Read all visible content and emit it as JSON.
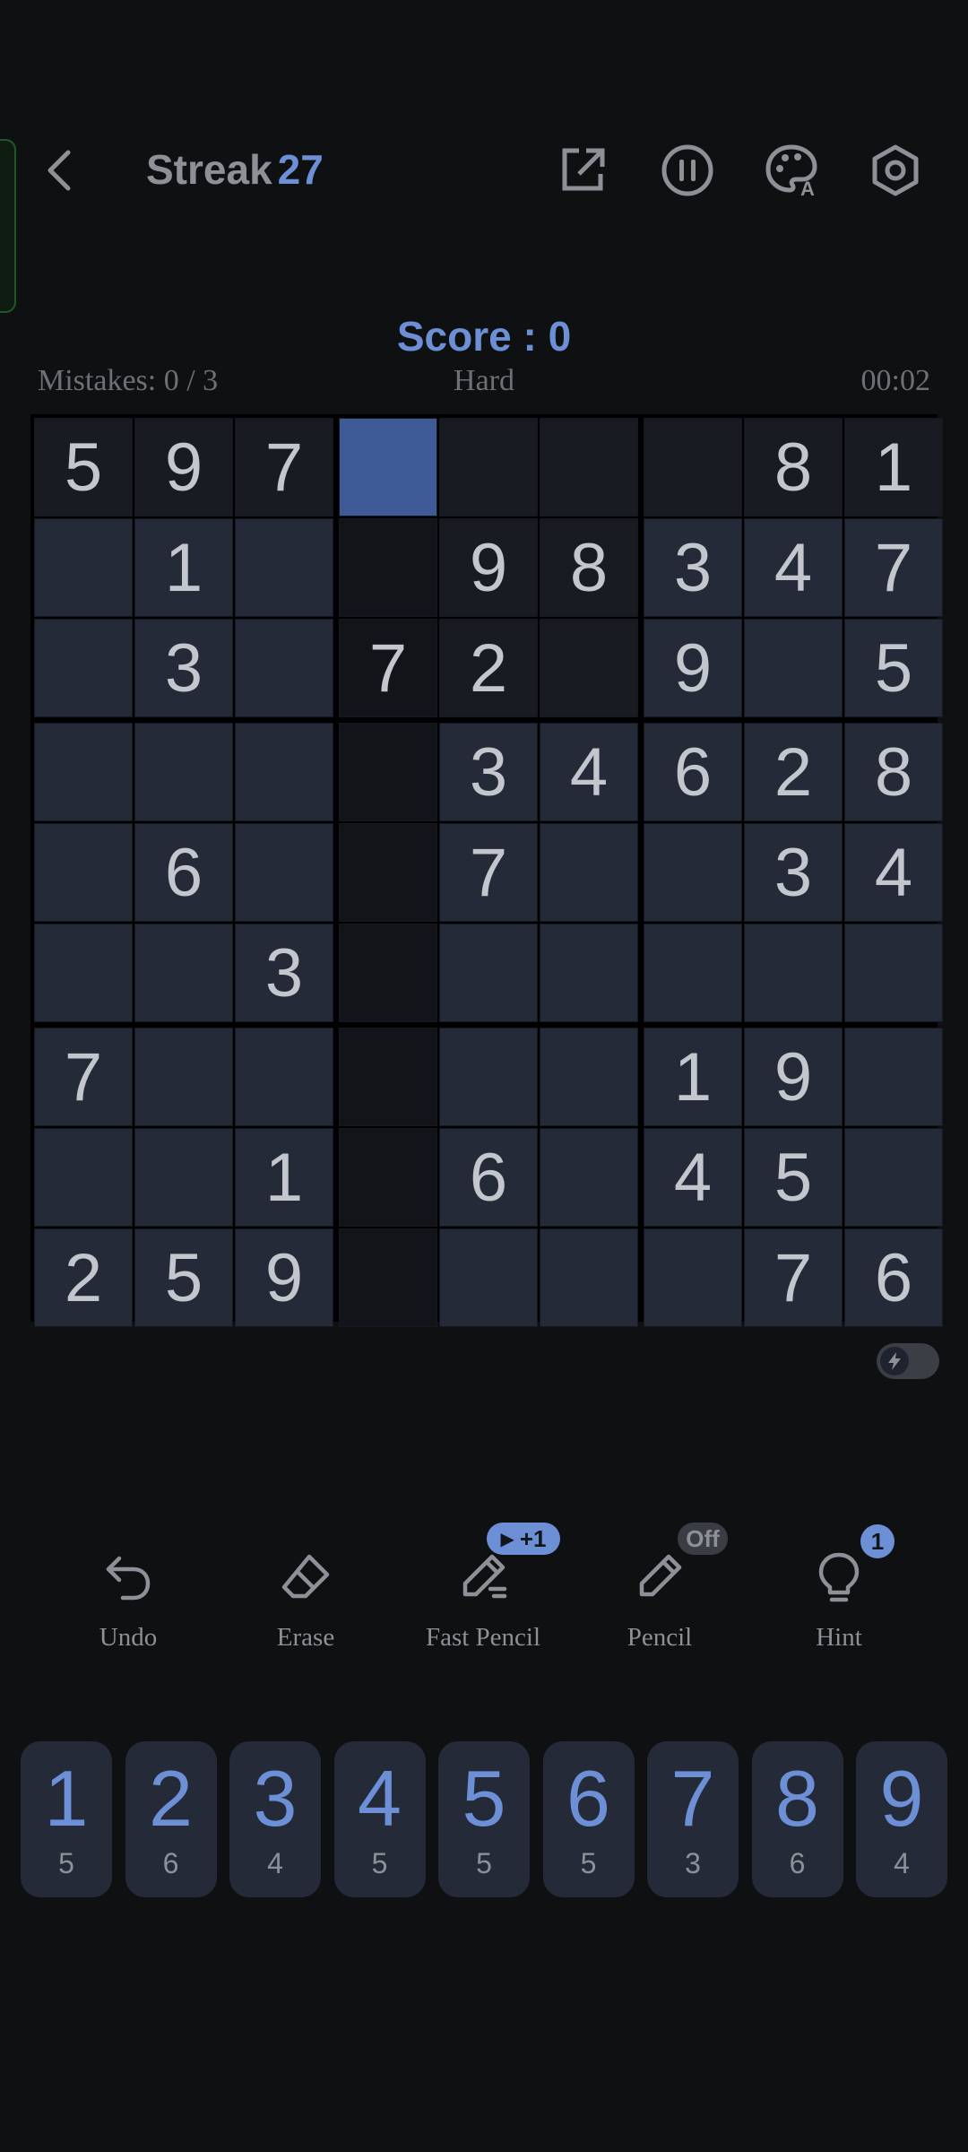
{
  "header": {
    "streak_label": "Streak",
    "streak_value": "27",
    "icons": [
      "back-icon",
      "share-icon",
      "pause-icon",
      "palette-icon",
      "settings-icon"
    ]
  },
  "score_text": "Score : 0",
  "info": {
    "mistakes": "Mistakes: 0 / 3",
    "difficulty": "Hard",
    "timer": "00:02"
  },
  "board": {
    "selected": [
      0,
      3
    ],
    "cells": [
      [
        "5",
        "9",
        "7",
        "",
        "",
        "",
        "",
        "8",
        "1"
      ],
      [
        "",
        "1",
        "",
        "",
        "9",
        "8",
        "3",
        "4",
        "7"
      ],
      [
        "",
        "3",
        "",
        "7",
        "2",
        "",
        "9",
        "",
        "5"
      ],
      [
        "",
        "",
        "",
        "",
        "3",
        "4",
        "6",
        "2",
        "8"
      ],
      [
        "",
        "6",
        "",
        "",
        "7",
        "",
        "",
        "3",
        "4"
      ],
      [
        "",
        "",
        "3",
        "",
        "",
        "",
        "",
        "",
        ""
      ],
      [
        "7",
        "",
        "",
        "",
        "",
        "",
        "1",
        "9",
        ""
      ],
      [
        "",
        "",
        "1",
        "",
        "6",
        "",
        "4",
        "5",
        ""
      ],
      [
        "2",
        "5",
        "9",
        "",
        "",
        "",
        "",
        "7",
        "6"
      ]
    ]
  },
  "tools": {
    "undo": {
      "label": "Undo"
    },
    "erase": {
      "label": "Erase"
    },
    "fast_pencil": {
      "label": "Fast Pencil",
      "badge": "+1"
    },
    "pencil": {
      "label": "Pencil",
      "badge": "Off"
    },
    "hint": {
      "label": "Hint",
      "badge": "1"
    }
  },
  "numpad": [
    {
      "digit": "1",
      "count": "5"
    },
    {
      "digit": "2",
      "count": "6"
    },
    {
      "digit": "3",
      "count": "4"
    },
    {
      "digit": "4",
      "count": "5"
    },
    {
      "digit": "5",
      "count": "5"
    },
    {
      "digit": "6",
      "count": "5"
    },
    {
      "digit": "7",
      "count": "3"
    },
    {
      "digit": "8",
      "count": "6"
    },
    {
      "digit": "9",
      "count": "4"
    }
  ],
  "colors": {
    "accent": "#6c8fd6",
    "background": "#0f1012",
    "cell": "#252a38",
    "selected": "#3e5a97"
  }
}
